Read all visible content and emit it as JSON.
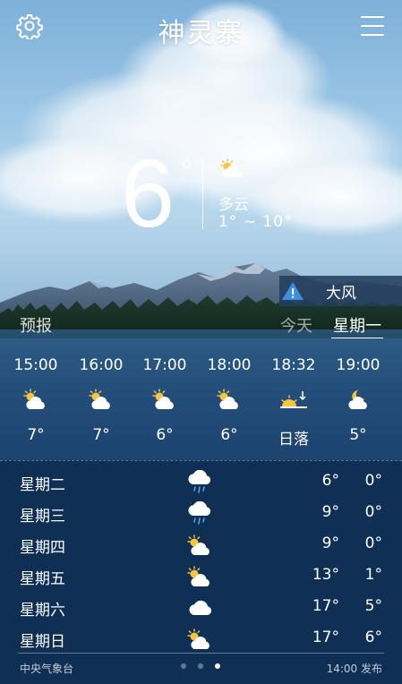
{
  "header": {
    "city": "神灵寨",
    "settings_icon": "gear-icon",
    "menu_icon": "hamburger-menu-icon"
  },
  "current": {
    "temperature": "6",
    "degree_symbol": "°",
    "condition": "多云",
    "range": "1° ~ 10°",
    "icon": "partly-cloudy-icon"
  },
  "alert": {
    "label": "大风",
    "icon": "warning-icon"
  },
  "tabs": {
    "forecast": "预报",
    "today": "今天",
    "selected": "星期一"
  },
  "hourly": [
    {
      "time": "15:00",
      "icon": "partly-cloudy-icon",
      "temp": "7°"
    },
    {
      "time": "16:00",
      "icon": "partly-cloudy-icon",
      "temp": "7°"
    },
    {
      "time": "17:00",
      "icon": "partly-cloudy-icon",
      "temp": "6°"
    },
    {
      "time": "18:00",
      "icon": "partly-cloudy-icon",
      "temp": "6°"
    },
    {
      "time": "18:32",
      "icon": "sunset-icon",
      "temp": "日落"
    },
    {
      "time": "19:00",
      "icon": "moon-cloudy-icon",
      "temp": "5°"
    }
  ],
  "daily": [
    {
      "day": "星期二",
      "icon": "rain-icon",
      "high": "6°",
      "low": "0°"
    },
    {
      "day": "星期三",
      "icon": "rain-icon",
      "high": "9°",
      "low": "0°"
    },
    {
      "day": "星期四",
      "icon": "partly-cloudy-icon",
      "high": "9°",
      "low": "0°"
    },
    {
      "day": "星期五",
      "icon": "partly-cloudy-icon",
      "high": "13°",
      "low": "1°"
    },
    {
      "day": "星期六",
      "icon": "cloudy-icon",
      "high": "17°",
      "low": "5°"
    },
    {
      "day": "星期日",
      "icon": "partly-cloudy-icon",
      "high": "17°",
      "low": "6°"
    }
  ],
  "footer": {
    "source": "中央气象台",
    "published": "14:00 发布",
    "page_count": 3,
    "active_page": 3
  },
  "colors": {
    "sky": "#9cc6e6",
    "panel": "#0f2f55",
    "hourly_panel": "#244f7a",
    "sun": "#f5c542",
    "alert_bg": "#243e5c",
    "alert_icon": "#3a8fe0"
  }
}
